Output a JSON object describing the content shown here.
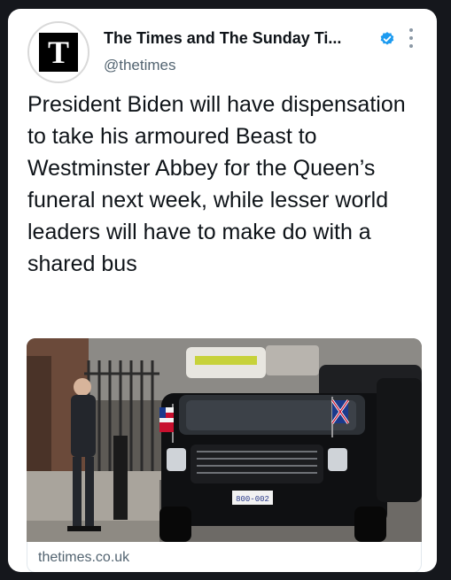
{
  "tweet": {
    "avatar_letter": "T",
    "display_name": "The Times and The Sunday Ti...",
    "handle": "@thetimes",
    "verified_icon": "verified-badge-icon",
    "more_icon": "more-options-icon",
    "text": "President Biden will have dispensation to take his armoured Beast to Westminster Abbey for the Queen’s funeral next week, while lesser world leaders will have to make do with a shared bus"
  },
  "link_card": {
    "domain": "thetimes.co.uk",
    "image_description_icon": "news-photo",
    "plate_text": "800-002"
  },
  "colors": {
    "page_background": "#15171c",
    "card_background": "#ffffff",
    "verified_blue": "#1d9bf0",
    "secondary_text": "#536471"
  }
}
